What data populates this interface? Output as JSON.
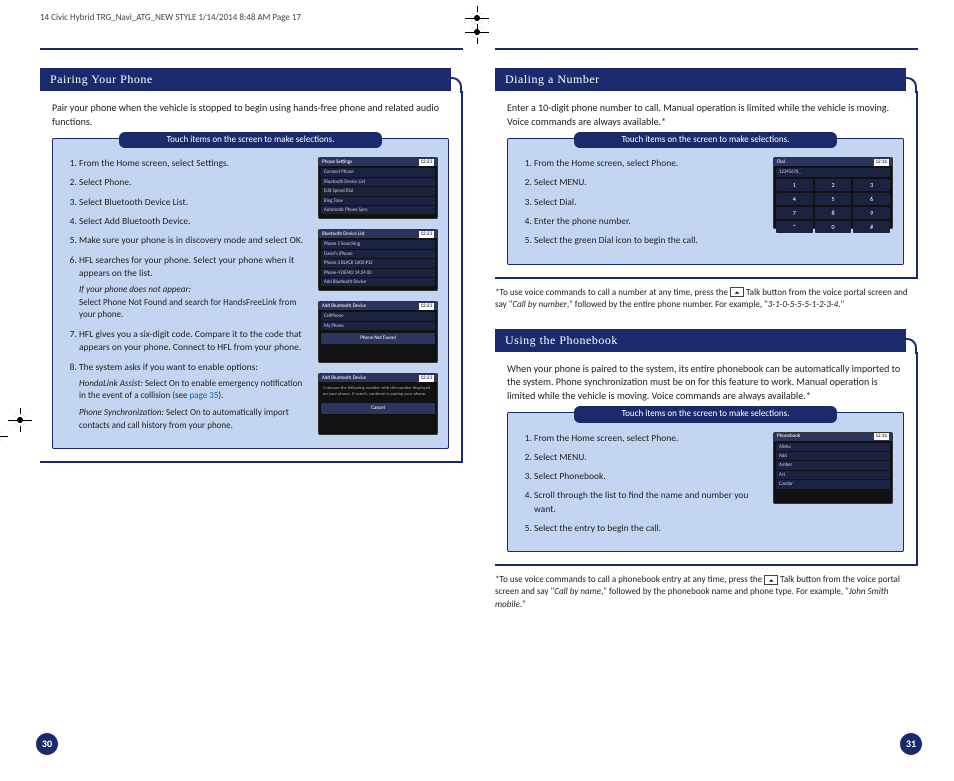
{
  "cropInfo": "14 Civic Hybrid TRG_Navi_ATG_NEW STYLE  1/14/2014  8:48 AM  Page 17",
  "left": {
    "pageNum": "30",
    "pairing": {
      "title": "Pairing Your Phone",
      "intro": "Pair your phone when the vehicle is stopped to begin using hands-free phone and related audio functions.",
      "boxHeader": "Touch items on the screen to make selections.",
      "steps": {
        "s1": "From the Home screen, select Settings.",
        "s2": "Select Phone.",
        "s3": "Select Bluetooth Device List.",
        "s4": "Select  Add Bluetooth Device.",
        "s5": "Make sure your phone is in discovery mode and select OK.",
        "s6": "HFL searches for your phone. Select your phone when it appears on the list.",
        "s6subEm": "If your phone does not appear:",
        "s6sub": "Select Phone Not Found and search for HandsFreeLink from your phone.",
        "s7": "HFL gives you a six-digit code. Compare it to the code that appears on your phone. Connect to HFL from your phone.",
        "s8": "The system asks if you want to enable options:",
        "s8aEm": "HondaLink Assist:",
        "s8a": " Select On to enable emergency notification in the event of a collision (see ",
        "s8aLink": "page 35",
        "s8aEnd": ").",
        "s8bEm": "Phone Synchronization:",
        "s8b": " Select On to automatically import contacts and call history from your phone."
      },
      "thumbs": {
        "t1": {
          "title": "Phone Settings",
          "clock": "12:23",
          "r1": "Connect Phone",
          "r2": "Bluetooth Device List",
          "r3": "Edit Speed Dial",
          "r4": "Ring Tone",
          "r5": "Automatic Phone Sync"
        },
        "t2": {
          "title": "Bluetooth Device List",
          "clock": "12:23",
          "r1": "Phone 1  Searching",
          "r2": "David's iPhone",
          "r3": "Phone 3  BLACK 1600 #12",
          "r4": "Phone 4  DEMO  14:24  00",
          "r5": "Add Bluetooth Device"
        },
        "t3": {
          "title": "Add Bluetooth Device",
          "clock": "12:23",
          "r1": "CellPhone",
          "r2": "My Phone",
          "btn": "Phone Not Found"
        },
        "t4": {
          "title": "Add Bluetooth Device",
          "clock": "12:23",
          "p": "Compare the following number with the number displayed on your phone. If match, continue in pairing your phone.",
          "btn": "Cancel"
        }
      }
    }
  },
  "right": {
    "pageNum": "31",
    "dialing": {
      "title": "Dialing a Number",
      "intro": "Enter a 10-digit phone number to call. Manual operation is limited while the vehicle is moving.  Voice commands are always available.*",
      "boxHeader": "Touch items on the screen to make selections.",
      "steps": {
        "s1": "From the Home screen, select Phone.",
        "s2": "Select MENU.",
        "s3": "Select Dial.",
        "s4": "Enter the phone number.",
        "s5": "Select the green Dial icon to begin the call."
      },
      "thumb": {
        "title": "Dial",
        "clock": "12:16",
        "num": "12345678_",
        "keys": [
          "1",
          "2",
          "3",
          "4",
          "5",
          "6",
          "7",
          "8",
          "9",
          "*",
          "0",
          "#"
        ]
      },
      "footnote": "*To use voice commands to call a number at any time, press the ",
      "footnote2": " Talk button from the voice portal screen and say \"",
      "footnoteEm1": "Call by number",
      "footnote3": ",\" followed by the entire phone number. For example, \"",
      "footnoteEm2": "3-1-0-5-5-5-1-2-3-4",
      "footnote4": ".\""
    },
    "phonebook": {
      "title": "Using the Phonebook",
      "intro": "When your phone is paired to the system, its entire phonebook can be automatically imported to the system. Phone synchronization must be on for this feature to work. Manual operation is limited while the vehicle is moving.  Voice commands are always available.*",
      "boxHeader": "Touch items on the screen to make selections.",
      "steps": {
        "s1": "From the Home screen, select Phone.",
        "s2": "Select MENU.",
        "s3": "Select Phonebook.",
        "s4": "Scroll through the list to find the name and number you want.",
        "s5": "Select the entry to begin the call."
      },
      "thumb": {
        "title": "Phonebook",
        "clock": "12:16",
        "r1": "Alisha",
        "r2": "Add",
        "r3": "Amber",
        "r4": "Art",
        "r5": "Candar"
      },
      "footnote": "*To use voice commands to call a phonebook entry at any time, press the ",
      "footnote2": " Talk button from the voice portal screen and say \"",
      "footnoteEm1": "Call by name",
      "footnote3": ",\" followed by the phonebook name and phone type. For example, \"",
      "footnoteEm2": "John Smith mobile",
      "footnote4": ".\""
    }
  }
}
